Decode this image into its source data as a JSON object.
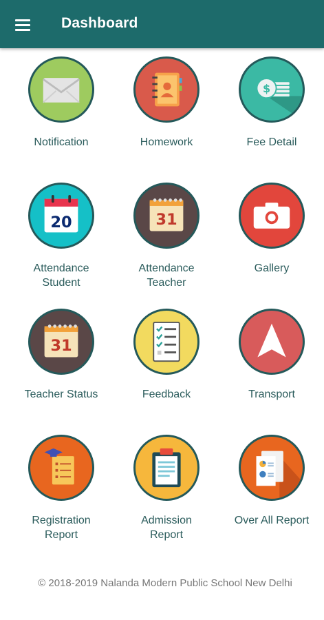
{
  "appbar": {
    "title": "Dashboard",
    "menu_icon": "hamburger-menu-icon",
    "color": "#1d6b6b"
  },
  "tiles": [
    {
      "label": "Notification",
      "icon": "envelope-icon",
      "bg": "#9ecb5f"
    },
    {
      "label": "Homework",
      "icon": "address-book-icon",
      "bg": "#d95a4b"
    },
    {
      "label": "Fee Detail",
      "icon": "money-coins-icon",
      "bg": "#3bb9a4"
    },
    {
      "label": "Attendance\nStudent",
      "icon": "calendar-20-icon",
      "bg": "#15c0c7"
    },
    {
      "label": "Attendance\nTeacher",
      "icon": "calendar-31-icon",
      "bg": "#5a4747"
    },
    {
      "label": "Gallery",
      "icon": "camera-icon",
      "bg": "#e2463c"
    },
    {
      "label": "Teacher Status",
      "icon": "calendar-31-icon",
      "bg": "#5a4747"
    },
    {
      "label": "Feedback",
      "icon": "checklist-icon",
      "bg": "#f2da5f"
    },
    {
      "label": "Transport",
      "icon": "navigation-arrow-icon",
      "bg": "#d85b5b"
    },
    {
      "label": "Registration\nReport",
      "icon": "graduation-report-icon",
      "bg": "#e8661f"
    },
    {
      "label": "Admission\nReport",
      "icon": "clipboard-icon",
      "bg": "#f6b73c"
    },
    {
      "label": "Over All Report",
      "icon": "report-chart-icon",
      "bg": "#e8661f"
    }
  ],
  "calendar_numbers": {
    "student": "20",
    "teacher": "31"
  },
  "footer": {
    "copyright": "© 2018-2019 Nalanda Modern Public School New Delhi"
  }
}
